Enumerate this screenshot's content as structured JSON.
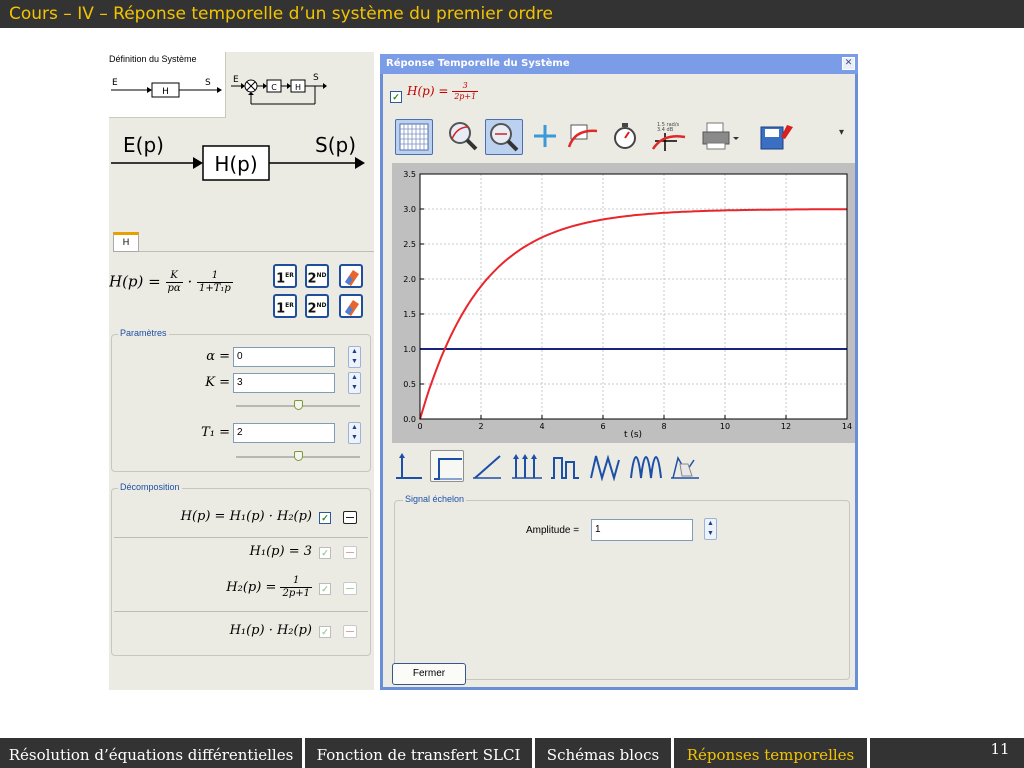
{
  "slide": {
    "title": "Cours – IV – Réponse temporelle d’un système du premier ordre",
    "page_number": "11"
  },
  "nav": {
    "items": [
      {
        "label": "Résolution d’équations différentielles",
        "active": false
      },
      {
        "label": "Fonction de transfert SLCI",
        "active": false
      },
      {
        "label": "Schémas blocs",
        "active": false
      },
      {
        "label": "Réponses temporelles",
        "active": true
      }
    ]
  },
  "left_panel": {
    "tab_title": "Définition du Système",
    "small_diagram": {
      "input": "E",
      "block": "H",
      "output": "S",
      "loop_block_c": "C",
      "loop_block_h": "H",
      "loop_output": "S",
      "loop_input": "E"
    },
    "big_diagram": {
      "input": "E(p)",
      "block": "H(p)",
      "output": "S(p)"
    },
    "sub_tab": "H",
    "formula": {
      "lhs": "H(p) =",
      "frac1_num": "K",
      "frac1_den": "pα",
      "dot": "·",
      "frac2_num": "1",
      "frac2_den": "1+T₁p"
    },
    "order_buttons": {
      "first": "1",
      "first_sup": "ER",
      "second": "2",
      "second_sup": "ND"
    },
    "parameters": {
      "title": "Paramètres",
      "alpha": {
        "label": "α =",
        "value": "0"
      },
      "k": {
        "label": "K =",
        "value": "3",
        "slider_fraction": 0.5
      },
      "t1": {
        "label": "T₁ =",
        "value": "2",
        "slider_fraction": 0.5
      }
    },
    "decomposition": {
      "title": "Décomposition",
      "rows": [
        {
          "formula": "H(p) = H₁(p) · H₂(p)"
        },
        {
          "formula": "H₁(p) = 3"
        },
        {
          "formula_lhs": "H₂(p) =",
          "num": "1",
          "den": "2p+1"
        },
        {
          "formula": "H₁(p) · H₂(p)"
        }
      ]
    }
  },
  "window": {
    "title": "Réponse Temporelle du Système",
    "close_glyph": "✕",
    "tf": {
      "lhs": "H(p) =",
      "num": "3",
      "den": "2p+1",
      "checked": true
    },
    "toolbar_icons": [
      "grid-icon",
      "zoom-fit-icon",
      "zoom-icon",
      "crosshair-icon",
      "curve-tool-icon",
      "stopwatch-icon",
      "bode-marker-icon",
      "printer-icon",
      "save-icon"
    ],
    "bode_marker_text": {
      "line1": "1.5 rad/s",
      "line2": "3.4 dB"
    },
    "more_glyph": "▾",
    "signal_icons": [
      "step-impulse-icon",
      "step-icon",
      "ramp-icon",
      "impulse-train-icon",
      "square-wave-icon",
      "sawtooth-icon",
      "sine-icon",
      "custom-signal-icon"
    ],
    "signal_box": {
      "title": "Signal échelon",
      "amplitude_label": "Amplitude =",
      "amplitude_value": "1"
    },
    "close_button": "Fermer"
  },
  "chart_data": {
    "type": "line",
    "xlabel": "t (s)",
    "ylabel": "",
    "xlim": [
      0,
      14
    ],
    "ylim": [
      0,
      3.5
    ],
    "x_ticks": [
      0,
      2,
      4,
      6,
      8,
      10,
      12,
      14
    ],
    "y_ticks": [
      "0.0",
      "0.5",
      "1.0",
      "1.5",
      "2.0",
      "2.5",
      "3.0",
      "3.5"
    ],
    "grid": true,
    "series": [
      {
        "kind": "first_order_step_response",
        "color": "#e8262b",
        "gain": 3,
        "time_constant": 2,
        "x": [
          0,
          0.5,
          1,
          1.5,
          2,
          3,
          4,
          5,
          6,
          7,
          8,
          9,
          10,
          11,
          12,
          13,
          14
        ],
        "y": [
          0,
          0.66,
          1.18,
          1.58,
          1.9,
          2.33,
          2.59,
          2.75,
          2.85,
          2.91,
          2.95,
          2.97,
          2.98,
          2.99,
          2.99,
          3.0,
          3.0
        ]
      },
      {
        "kind": "step_input",
        "color": "#1a237e",
        "x": [
          0,
          14
        ],
        "y": [
          1,
          1
        ]
      }
    ]
  }
}
